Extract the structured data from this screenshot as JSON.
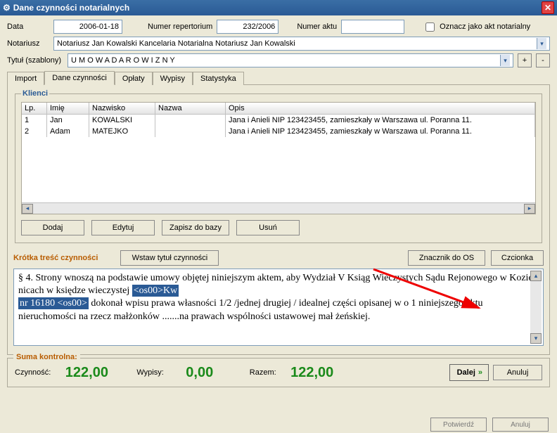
{
  "window": {
    "title": "Dane czynności notarialnych"
  },
  "form": {
    "data_label": "Data",
    "data_value": "2006-01-18",
    "numer_rep_label": "Numer repertorium",
    "numer_rep_value": "232/2006",
    "numer_aktu_label": "Numer aktu",
    "numer_aktu_value": "",
    "oznacz_label": "Oznacz jako akt notarialny",
    "notariusz_label": "Notariusz",
    "notariusz_value": "Notariusz Jan Kowalski Kancelaria Notarialna Notariusz Jan Kowalski",
    "tytul_label": "Tytuł (szablony)",
    "tytul_value": "U M O W A   D A R O W I Z N Y",
    "plus_label": "+",
    "minus_label": "-"
  },
  "tabs": {
    "import": "Import",
    "dane": "Dane czynności",
    "oplaty": "Opłaty",
    "wypisy": "Wypisy",
    "statystyka": "Statystyka"
  },
  "klienci": {
    "title": "Klienci",
    "headers": {
      "lp": "Lp.",
      "imie": "Imię",
      "nazw": "Nazwisko",
      "nazwa": "Nazwa",
      "opis": "Opis"
    },
    "rows": [
      {
        "lp": "1",
        "imie": "Jan",
        "nazw": "KOWALSKI",
        "nazwa": "",
        "opis": "Jana i Anieli NIP 123423455, zamieszkały w Warszawa ul. Poranna 11."
      },
      {
        "lp": "2",
        "imie": "Adam",
        "nazw": "MATEJKO",
        "nazwa": "",
        "opis": "Jana i Anieli NIP 123423455, zamieszkały w Warszawa ul. Poranna 11."
      }
    ],
    "buttons": {
      "dodaj": "Dodaj",
      "edytuj": "Edytuj",
      "zapisz": "Zapisz do bazy",
      "usun": "Usuń"
    }
  },
  "tresc": {
    "title": "Krótka treść czynności",
    "btn_wstaw": "Wstaw tytuł czynności",
    "btn_znacznik": "Znacznik do OS",
    "btn_czcionka": "Czcionka",
    "body_pre": "§ 4. Strony wnoszą na podstawie umowy objętej niniejszym aktem, aby Wydział V Ksiąg Wieczystych Sądu Rejonowego w Kozie nicach w księdze wieczystej ",
    "hl1": "<os00>Kw",
    "hl2": "nr 16180 <os00>",
    "body_post": " dokonał wpisu prawa własności 1/2 /jednej drugiej / idealnej części opisanej w o 1 niniejszego aktu nieruchomości na rzecz małżonków .......na prawach wspólności ustawowej mał żeńskiej."
  },
  "suma": {
    "title": "Suma kontrolna:",
    "czynnosc_label": "Czynność:",
    "czynnosc_val": "122,00",
    "wypisy_label": "Wypisy:",
    "wypisy_val": "0,00",
    "razem_label": "Razem:",
    "razem_val": "122,00",
    "dalej": "Dalej",
    "anuluj": "Anuluj"
  },
  "footer": {
    "potwierdz": "Potwierdź",
    "anuluj2": "Anuluj"
  }
}
